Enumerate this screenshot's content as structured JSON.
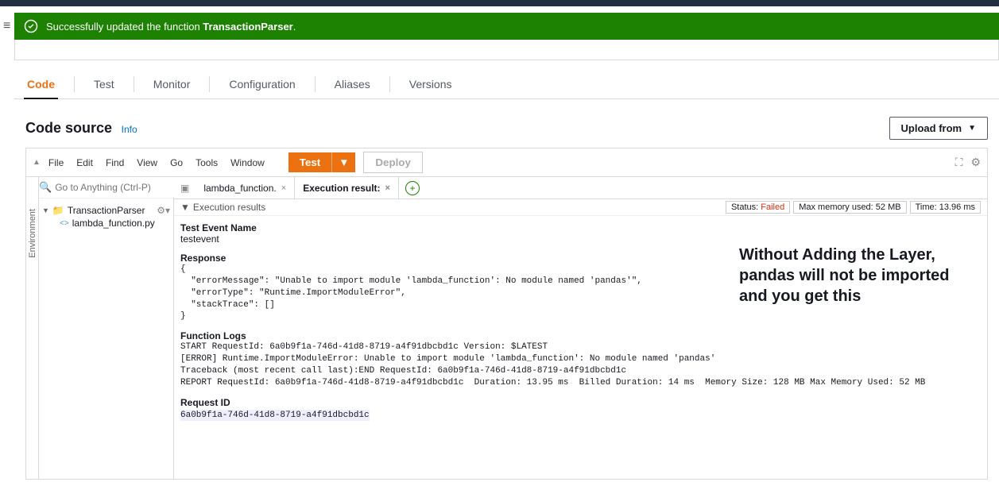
{
  "banner": {
    "prefix": "Successfully updated the function ",
    "name": "TransactionParser",
    "suffix": "."
  },
  "tabs": [
    "Code",
    "Test",
    "Monitor",
    "Configuration",
    "Aliases",
    "Versions"
  ],
  "section": {
    "title": "Code source",
    "info": "Info",
    "upload": "Upload from"
  },
  "ide_menu": [
    "File",
    "Edit",
    "Find",
    "View",
    "Go",
    "Tools",
    "Window"
  ],
  "buttons": {
    "test": "Test",
    "deploy": "Deploy"
  },
  "search_placeholder": "Go to Anything (Ctrl-P)",
  "env_label": "Environment",
  "tree": {
    "root": "TransactionParser",
    "file": "lambda_function.py"
  },
  "editor_tabs": {
    "file": "lambda_function.",
    "result": "Execution result:"
  },
  "results": {
    "header": "Execution results",
    "status_label": "Status: ",
    "status_value": "Failed",
    "mem_label": "Max memory used: ",
    "mem_value": "52 MB",
    "time_label": "Time: ",
    "time_value": "13.96 ms",
    "test_event_label": "Test Event Name",
    "test_event_value": "testevent",
    "response_label": "Response",
    "response_body": "{\n  \"errorMessage\": \"Unable to import module 'lambda_function': No module named 'pandas'\",\n  \"errorType\": \"Runtime.ImportModuleError\",\n  \"stackTrace\": []\n}",
    "logs_label": "Function Logs",
    "logs_body": "START RequestId: 6a0b9f1a-746d-41d8-8719-a4f91dbcbd1c Version: $LATEST\n[ERROR] Runtime.ImportModuleError: Unable to import module 'lambda_function': No module named 'pandas'\nTraceback (most recent call last):END RequestId: 6a0b9f1a-746d-41d8-8719-a4f91dbcbd1c\nREPORT RequestId: 6a0b9f1a-746d-41d8-8719-a4f91dbcbd1c  Duration: 13.95 ms  Billed Duration: 14 ms  Memory Size: 128 MB Max Memory Used: 52 MB",
    "reqid_label": "Request ID",
    "reqid_value": "6a0b9f1a-746d-41d8-8719-a4f91dbcbd1c"
  },
  "annotation": "Without Adding the Layer, pandas will not be imported and you get this"
}
